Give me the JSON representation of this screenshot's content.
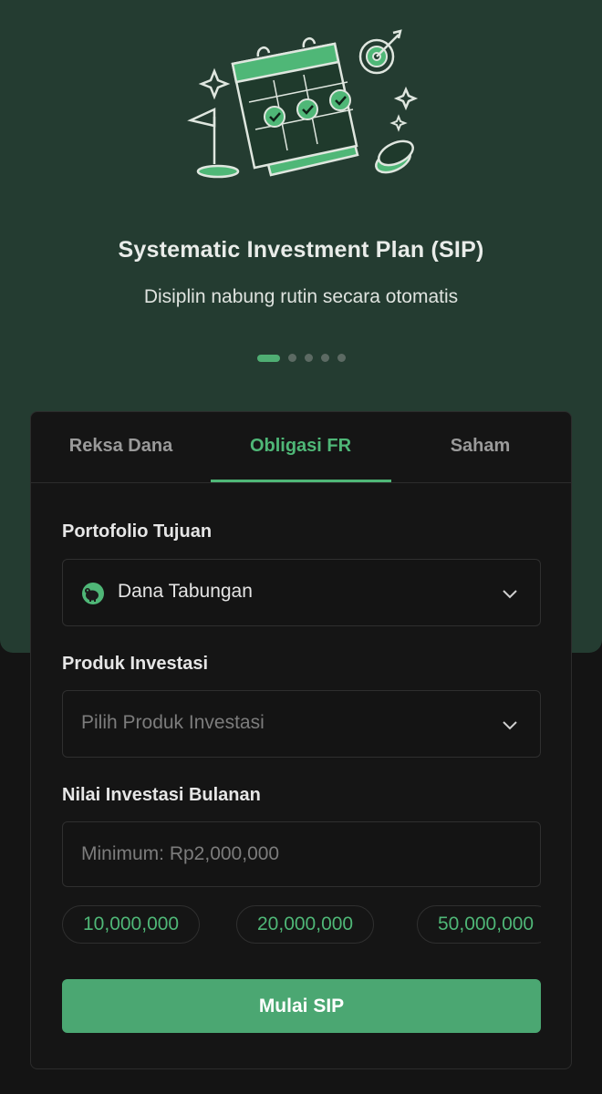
{
  "hero": {
    "title": "Systematic Investment Plan (SIP)",
    "subtitle": "Disiplin nabung rutin secara otomatis",
    "carousel": {
      "total": 5,
      "active_index": 0
    },
    "illustration_icon": "calendar-checklist-target-icon"
  },
  "tabs": [
    {
      "label": "Reksa Dana",
      "active": false
    },
    {
      "label": "Obligasi FR",
      "active": true
    },
    {
      "label": "Saham",
      "active": false
    }
  ],
  "form": {
    "portfolio": {
      "label": "Portofolio Tujuan",
      "value": "Dana Tabungan",
      "icon": "piggy-bank-icon"
    },
    "product": {
      "label": "Produk Investasi",
      "placeholder": "Pilih Produk Investasi"
    },
    "amount": {
      "label": "Nilai Investasi Bulanan",
      "placeholder": "Minimum: Rp2,000,000"
    },
    "chips": [
      "10,000,000",
      "20,000,000",
      "50,000,000"
    ],
    "submit_label": "Mulai SIP"
  },
  "colors": {
    "accent": "#4fb777",
    "hero_background": "#243c31",
    "page_background": "#141414",
    "button": "#4ba772"
  }
}
